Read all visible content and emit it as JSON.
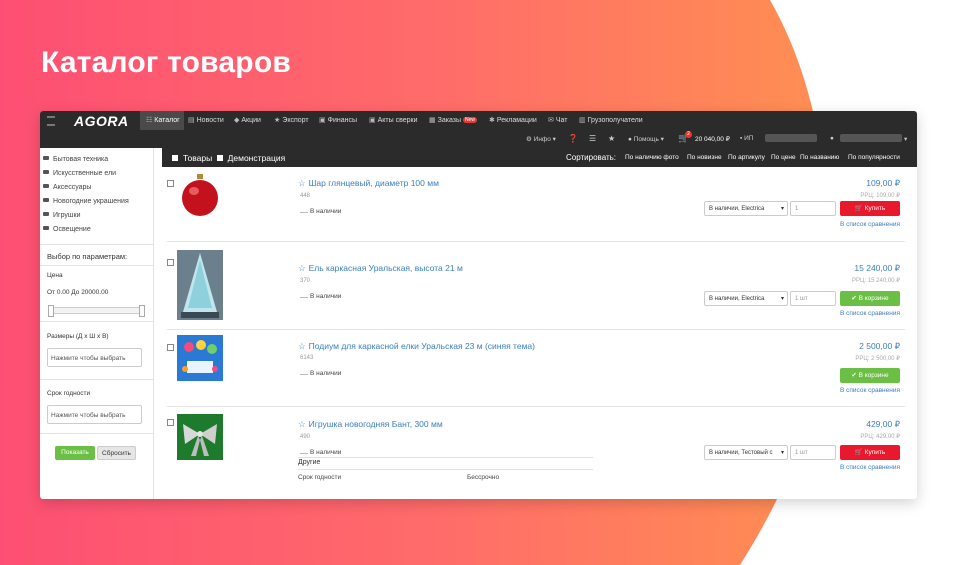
{
  "slide_title": "Каталог товаров",
  "nav": {
    "logo": "AGORA",
    "items": [
      {
        "label": "Каталог",
        "icon": "sitemap-icon"
      },
      {
        "label": "Новости",
        "icon": "file-icon"
      },
      {
        "label": "Акции",
        "icon": "tag-icon"
      },
      {
        "label": "Экспорт",
        "icon": "star-icon"
      },
      {
        "label": "Финансы",
        "icon": "money-icon"
      },
      {
        "label": "Акты сверки",
        "icon": "money-icon"
      },
      {
        "label": "Заказы",
        "icon": "list-icon",
        "badge": "New"
      },
      {
        "label": "Рекламации",
        "icon": "gear-icon"
      },
      {
        "label": "Чат",
        "icon": "mail-icon"
      },
      {
        "label": "Грузополучатели",
        "icon": "building-icon"
      }
    ],
    "second_row": {
      "info": "Инфо",
      "help": "Помощь",
      "cart_count": "2",
      "cart_total": "20 040,00 ₽",
      "company": "ИП"
    }
  },
  "sidebar": {
    "categories": [
      "Бытовая техника",
      "Искусственные ели",
      "Аксессуары",
      "Новогодние украшения",
      "Игрушки",
      "Освещение"
    ],
    "params_title": "Выбор по параметрам:",
    "price_label": "Цена",
    "price_range": "От 0.00 До 20000.00",
    "size_label": "Размеры (Д х Ш х В)",
    "size_placeholder": "Нажмите чтобы выбрать",
    "shelf_label": "Срок годности",
    "shelf_placeholder": "Нажмите чтобы выбрать",
    "show_button": "Показать",
    "reset_button": "Сбросить"
  },
  "toolbar": {
    "goods_label": "Товары",
    "demo_label": "Демонстрация",
    "sort_label": "Сортировать:",
    "sort_options": [
      "По наличию фото",
      "По новизне",
      "По артикулу",
      "По цене",
      "По названию",
      "По популярности"
    ]
  },
  "products": [
    {
      "title": "Шар глянцевый, диаметр 100 мм",
      "code": "448",
      "availability": "В наличии",
      "price": "109,00 ₽",
      "rrp": "РРЦ: 109,00 ₽",
      "warehouse": "В наличии, Electrica",
      "qty": "1",
      "action": "Купить",
      "action_type": "buy",
      "compare": "В список сравнения"
    },
    {
      "title": "Ель каркасная Уральская, высота 21 м",
      "code": "370",
      "availability": "В наличии",
      "price": "15 240,00 ₽",
      "rrp": "РРЦ: 15 240,00 ₽",
      "warehouse": "В наличии, Electrica",
      "qty": "1 шт",
      "action": "В корзине",
      "action_type": "incart",
      "compare": "В список сравнения"
    },
    {
      "title": "Подиум для каркасной елки Уральская 23 м (синяя тема)",
      "code": "6143",
      "availability": "В наличии",
      "price": "2 500,00 ₽",
      "rrp": "РРЦ: 2 500,00 ₽",
      "action": "В корзине",
      "action_type": "incart",
      "compare": "В список сравнения"
    },
    {
      "title": "Игрушка новогодняя Бант, 300 мм",
      "code": "490",
      "availability": "В наличии",
      "price": "429,00 ₽",
      "rrp": "РРЦ: 429,00 ₽",
      "warehouse": "В наличии, Тестовый с",
      "qty": "1 шт",
      "action": "Купить",
      "action_type": "buy",
      "compare": "В список сравнения",
      "extra_title": "Другие",
      "extra_key": "Срок годности",
      "extra_value": "Бессрочно"
    }
  ],
  "colors": {
    "accent_blue": "#3a7fc1",
    "buy_red": "#e8192c",
    "incart_green": "#6bbf45",
    "nav_dark": "#2b2b2b"
  }
}
